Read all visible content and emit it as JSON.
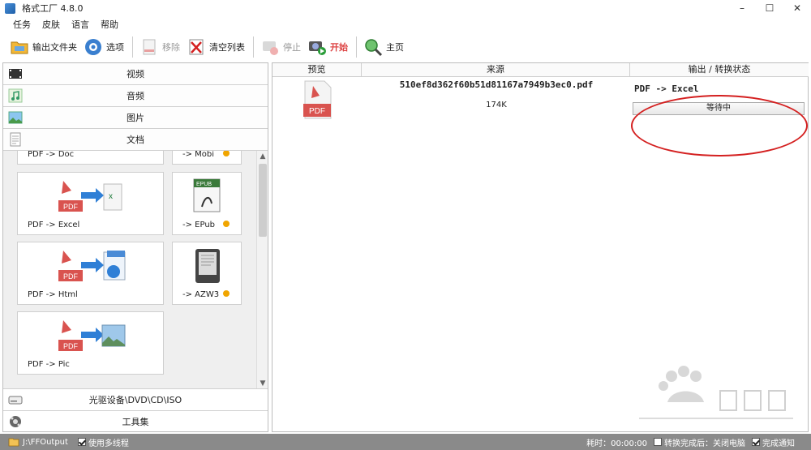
{
  "window": {
    "title": "格式工厂 4.8.0",
    "minimize": "–",
    "maximize": "☐",
    "close": "✕"
  },
  "menu": [
    "任务",
    "皮肤",
    "语言",
    "帮助"
  ],
  "toolbar": {
    "output_folder": "输出文件夹",
    "options": "选项",
    "remove": "移除",
    "clear_list": "清空列表",
    "stop": "停止",
    "start": "开始",
    "home": "主页"
  },
  "categories": {
    "video": "视频",
    "audio": "音频",
    "image": "图片",
    "document": "文档",
    "optical": "光驱设备\\DVD\\CD\\ISO",
    "tools": "工具集"
  },
  "tiles": {
    "pdf_doc": "PDF -> Doc",
    "mobi": "-> Mobi",
    "pdf_excel": "PDF -> Excel",
    "epub": "-> EPub",
    "pdf_html": "PDF -> Html",
    "azw3": "-> AZW3",
    "pdf_pic": "PDF -> Pic"
  },
  "task_table": {
    "headers": {
      "preview": "预览",
      "source": "来源",
      "status": "输出 / 转换状态"
    },
    "row": {
      "filename": "510ef8d362f60b51d81167a7949b3ec0.pdf",
      "size": "174K",
      "conversion": "PDF -> Excel",
      "status": "等待中",
      "preview_badge": "PDF"
    }
  },
  "statusbar": {
    "output_path": "J:\\FFOutput",
    "multithread": "使用多线程",
    "elapsed": "耗时：00:00:00",
    "after_done": "转换完成后：关闭电脑",
    "notify": "完成通知"
  },
  "colors": {
    "accent_red": "#d42020",
    "pdf_red": "#d9534f",
    "statusbar": "#8a8a8a",
    "dot": "#f0a500"
  }
}
